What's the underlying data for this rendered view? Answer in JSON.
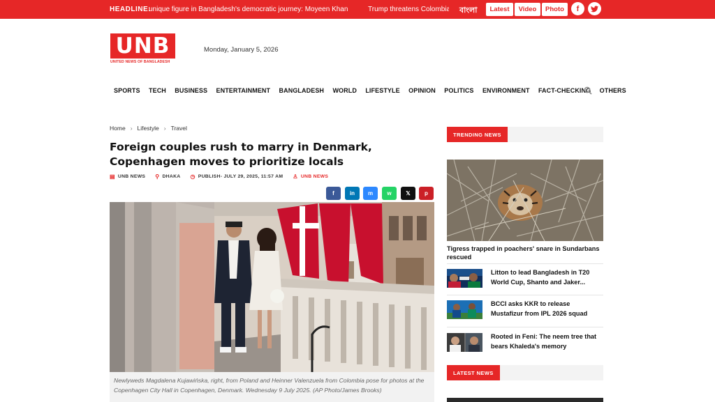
{
  "topbar": {
    "headline_label": "HEADLINE:",
    "ticker": [
      "unique figure in Bangladesh's democratic journey: Moyeen Khan",
      "Trump threatens Colombia, wo"
    ],
    "bangla_label": "বাংলা",
    "buttons": [
      "Latest",
      "Video",
      "Photo"
    ],
    "social": {
      "facebook": "f",
      "twitter": "t"
    }
  },
  "brand": {
    "logo_text": "UNB",
    "logo_tagline": "UNITED NEWS OF BANGLADESH",
    "date": "Monday, January 5, 2026",
    "accent": "#e62727"
  },
  "nav": [
    "SPORTS",
    "TECH",
    "BUSINESS",
    "ENTERTAINMENT",
    "BANGLADESH",
    "WORLD",
    "LIFESTYLE",
    "OPINION",
    "POLITICS",
    "ENVIRONMENT",
    "FACT-CHECKING",
    "OTHERS"
  ],
  "breadcrumb": [
    "Home",
    "Lifestyle",
    "Travel"
  ],
  "article": {
    "headline": "Foreign couples rush to marry in Denmark, Copenhagen moves to prioritize locals",
    "meta": {
      "source": "UNB NEWS",
      "location": "DHAKA",
      "published": "PUBLISH- JULY 29, 2025, 11:57 AM",
      "author": "UNB NEWS"
    },
    "share": [
      {
        "name": "facebook",
        "glyph": "f",
        "color": "#3b5998"
      },
      {
        "name": "linkedin",
        "glyph": "in",
        "color": "#0077b5"
      },
      {
        "name": "messenger",
        "glyph": "m",
        "color": "#2d88ff"
      },
      {
        "name": "whatsapp",
        "glyph": "w",
        "color": "#25d366"
      },
      {
        "name": "x",
        "glyph": "𝕏",
        "color": "#111111"
      },
      {
        "name": "pinterest",
        "glyph": "p",
        "color": "#cb2027"
      }
    ],
    "caption": "Newlyweds Magdalena Kujawińska, right, from Poland and Heinner Valenzuela from Colombia pose for photos at the Copenhagen City Hall in Copenhagen, Denmark. Wednesday 9 July 2025. (AP Photo/James Brooks)"
  },
  "sidebar": {
    "trending_label": "TRENDING NEWS",
    "trending_main": "Tigress trapped in poachers' snare in Sundarbans rescued",
    "items": [
      {
        "title": "Litton to lead Bangladesh in T20 World Cup, Shanto and Jaker..."
      },
      {
        "title": "BCCI asks KKR to release Mustafizur from IPL 2026 squad"
      },
      {
        "title": "Rooted in Feni: The neem tree that bears Khaleda's memory"
      }
    ],
    "latest_label": "LATEST NEWS"
  }
}
